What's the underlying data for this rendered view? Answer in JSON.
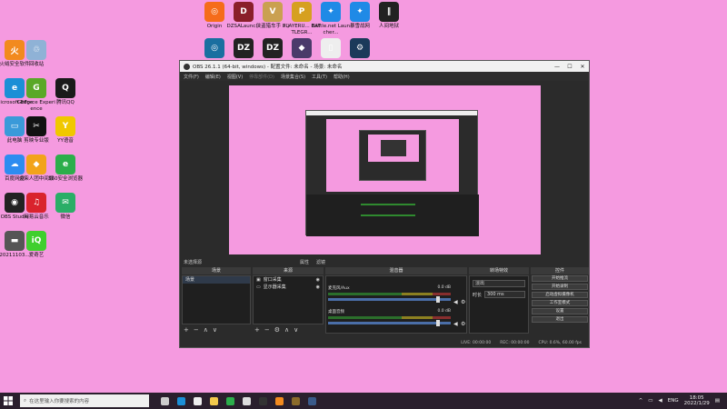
{
  "desktop_icons": [
    {
      "label": "火绒安全软件",
      "color": "#f28a1e",
      "glyph": "火"
    },
    {
      "label": "回收站",
      "color": "#8fb2d6",
      "glyph": "♲"
    },
    {
      "label": "Microsoft Edge",
      "color": "#1b8fd6",
      "glyph": "e"
    },
    {
      "label": "GeForce Experience",
      "color": "#5aa828",
      "glyph": "G"
    },
    {
      "label": "腾讯QQ",
      "color": "#1a1a1a",
      "glyph": "Q"
    },
    {
      "label": "此电脑",
      "color": "#3a9ad9",
      "glyph": "▭"
    },
    {
      "label": "剪映专业版",
      "color": "#111111",
      "glyph": "✂"
    },
    {
      "label": "YY语音",
      "color": "#f0c800",
      "glyph": "Y"
    },
    {
      "label": "百度网盘",
      "color": "#2d8cf0",
      "glyph": "☁"
    },
    {
      "label": "火柴人团中间版",
      "color": "#f2a31a",
      "glyph": "◆"
    },
    {
      "label": "360安全浏览器",
      "color": "#2cae4b",
      "glyph": "e"
    },
    {
      "label": "OBS Studio",
      "color": "#222222",
      "glyph": "◉"
    },
    {
      "label": "网易云音乐",
      "color": "#d9232d",
      "glyph": "♫"
    },
    {
      "label": "微信",
      "color": "#2aae67",
      "glyph": "✉"
    },
    {
      "label": "20211103...",
      "color": "#555555",
      "glyph": "▬"
    },
    {
      "label": "爱奇艺",
      "color": "#3fcf2e",
      "glyph": "iQ"
    },
    {
      "label": "Origin",
      "color": "#f56c1a",
      "glyph": "◎"
    },
    {
      "label": "DZSALaunc...",
      "color": "#8a1f2a",
      "glyph": "D"
    },
    {
      "label": "侠盗猎车手 5 )",
      "color": "#caa050",
      "glyph": "V"
    },
    {
      "label": "PLAYERU... BATTLEGR...",
      "color": "#d6a020",
      "glyph": "P"
    },
    {
      "label": "Battle.net Launcher...",
      "color": "#1f8ae6",
      "glyph": "✦"
    },
    {
      "label": "暴雪战网",
      "color": "#1f8ae6",
      "glyph": "✦"
    },
    {
      "label": "人间地狱",
      "color": "#222222",
      "glyph": "‖"
    },
    {
      "label": "",
      "color": "#1a6fa0",
      "glyph": "◎"
    },
    {
      "label": "",
      "color": "#222222",
      "glyph": "DZ"
    },
    {
      "label": "",
      "color": "#222222",
      "glyph": "DZ"
    },
    {
      "label": "",
      "color": "#4a3a6a",
      "glyph": "◆"
    },
    {
      "label": "",
      "color": "#eeeeee",
      "glyph": "▯"
    },
    {
      "label": "",
      "color": "#1b3a5a",
      "glyph": "⚙"
    }
  ],
  "obs": {
    "title": "OBS 26.1.1 (64-bit, windows) - 配置文件: 未命名 - 场景: 未命名",
    "window_controls": [
      "—",
      "☐",
      "✕"
    ],
    "menu": [
      "文件(F)",
      "编辑(E)",
      "视图(V)",
      "停靠部件(D)",
      "场景集合(S)",
      "工具(T)",
      "帮助(H)"
    ],
    "no_source_label": "未选择源",
    "properties_label": "属性",
    "filters_label": "滤镜",
    "docks": {
      "scenes": "场景",
      "sources": "来源",
      "mixer": "混音器",
      "transitions": "转场特效",
      "controls": "控件"
    },
    "scene_list": [
      "场景"
    ],
    "source_list": [
      "窗口采集",
      "显示器采集"
    ],
    "mixer_channels": [
      {
        "name": "麦克风/Aux",
        "db": "0.0 dB"
      },
      {
        "name": "桌面音频",
        "db": "0.0 dB"
      }
    ],
    "transition": {
      "type": "淡出",
      "duration_label": "时长",
      "duration": "300 ms"
    },
    "controls_buttons": [
      "开始推流",
      "开始录制",
      "启动虚拟摄像机",
      "工作室模式",
      "设置",
      "退出"
    ],
    "status": {
      "live": "LIVE: 00:00:00",
      "rec": "REC: 00:00:00",
      "cpu": "CPU: 0.6%, 60.00 fps"
    }
  },
  "taskbar": {
    "search_placeholder": "在这里输入你要搜索的内容",
    "pinned": [
      {
        "name": "task-view-icon",
        "color": "#cccccc"
      },
      {
        "name": "edge-icon",
        "color": "#1b8fd6"
      },
      {
        "name": "store-icon",
        "color": "#eeeeee"
      },
      {
        "name": "explorer-icon",
        "color": "#f2c94c"
      },
      {
        "name": "360-icon",
        "color": "#2cae4b"
      },
      {
        "name": "obs-icon",
        "color": "#dddddd"
      },
      {
        "name": "gta-icon",
        "color": "#333333"
      },
      {
        "name": "orange-app-icon",
        "color": "#f28a1e"
      },
      {
        "name": "game-icon",
        "color": "#8a6a2a"
      },
      {
        "name": "steam-icon",
        "color": "#3a5a8a"
      }
    ],
    "lang": "ENG",
    "time": "18:05",
    "date": "2022/1/29"
  }
}
